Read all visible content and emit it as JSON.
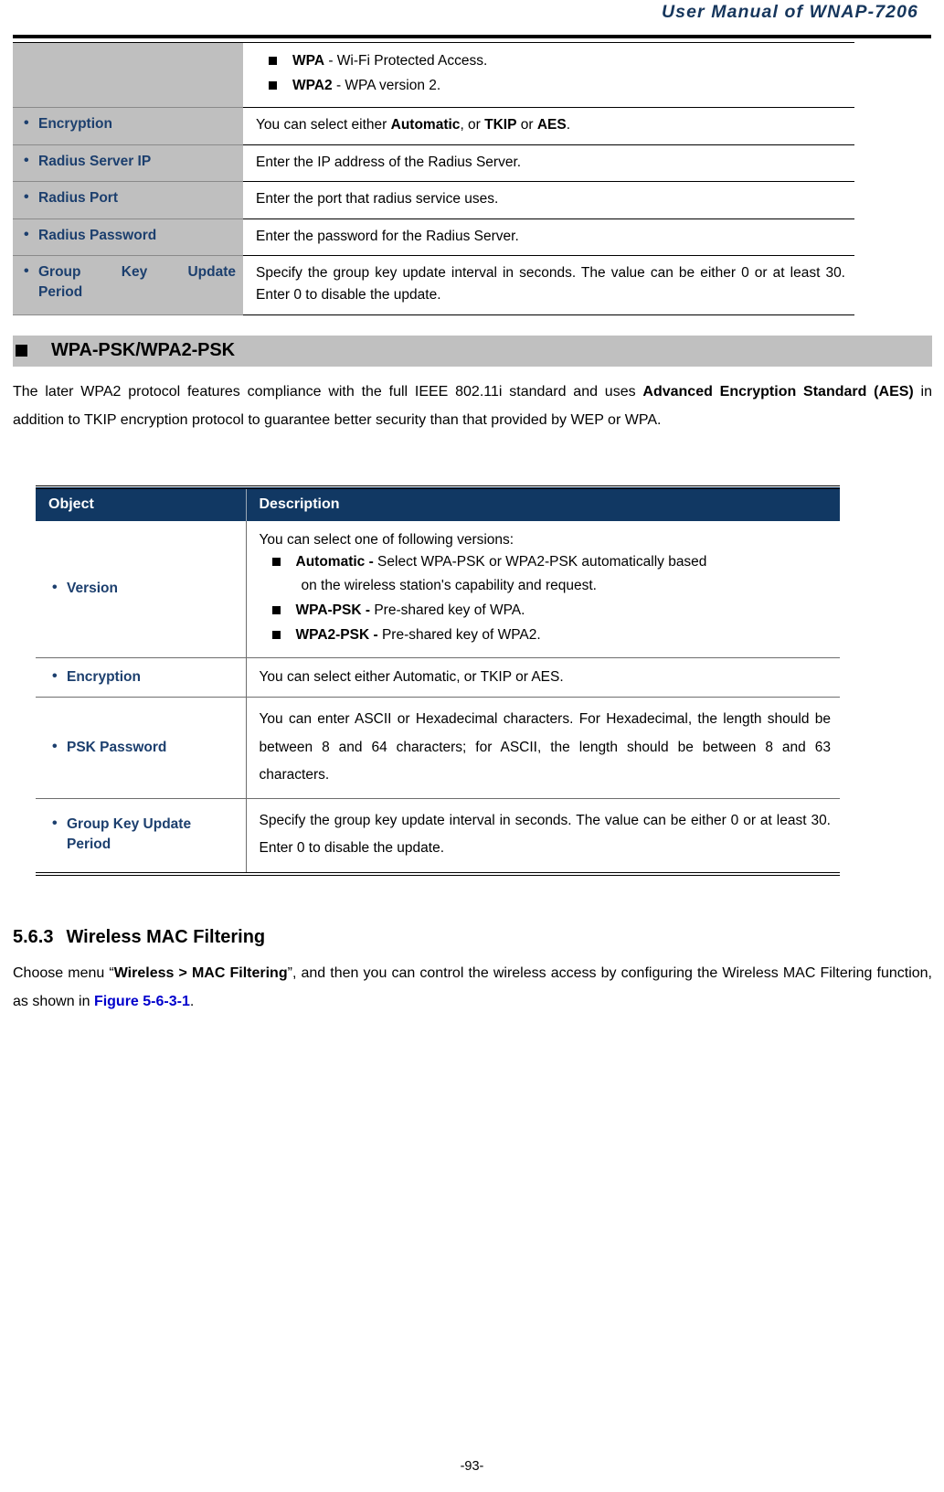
{
  "header": {
    "title": "User Manual of WNAP-7206"
  },
  "table_continued": {
    "rows": [
      {
        "object": "",
        "bullets": [
          {
            "term": "WPA",
            "rest": " - Wi-Fi Protected Access."
          },
          {
            "term": "WPA2",
            "rest": " - WPA version 2."
          }
        ]
      },
      {
        "object": "Encryption",
        "description_html": "You can select either <b>Automatic</b>, or <b>TKIP</b> or <b>AES</b>."
      },
      {
        "object": "Radius Server IP",
        "description_html": "Enter the IP address of the Radius Server."
      },
      {
        "object": "Radius Port",
        "description_html": "Enter the port that radius service uses."
      },
      {
        "object": "Radius Password",
        "description_html": "Enter the password for the Radius Server."
      },
      {
        "object": "Group Key Update",
        "object_line2": "Period",
        "description_html": "Specify the group key update interval in seconds. The value can be either 0 or at least 30. Enter 0 to disable the update."
      }
    ]
  },
  "section_banner": {
    "label": "WPA-PSK/WPA2-PSK"
  },
  "intro_paragraph": {
    "html": "The later WPA2 protocol features compliance with the full IEEE 802.11i standard and uses <b>Advanced Encryption Standard (AES)</b> in addition to TKIP encryption protocol to guarantee better security than that provided by WEP or WPA."
  },
  "table_psk": {
    "headers": {
      "object": "Object",
      "description": "Description"
    },
    "rows": [
      {
        "object": "Version",
        "intro": "You can select one of following versions:",
        "bullets": [
          {
            "term": "Automatic -",
            "rest": " Select WPA-PSK or WPA2-PSK automatically based",
            "rest2": "on the wireless station's capability and request."
          },
          {
            "term": "WPA-PSK -",
            "rest": " Pre-shared key of WPA."
          },
          {
            "term": "WPA2-PSK -",
            "rest": " Pre-shared key of WPA2."
          }
        ]
      },
      {
        "object": "Encryption",
        "description": "You can select either Automatic, or TKIP or AES."
      },
      {
        "object": "PSK Password",
        "description": "You can enter ASCII or Hexadecimal characters. For Hexadecimal, the length should be between 8 and 64 characters; for ASCII, the length should be between 8 and 63 characters."
      },
      {
        "object": "Group Key Update",
        "object_line2": "Period",
        "description": "Specify the group key update interval in seconds. The value can be either 0 or at least 30. Enter 0 to disable the update."
      }
    ]
  },
  "heading": {
    "number": "5.6.3",
    "title": "Wireless MAC Filtering"
  },
  "closing_paragraph": {
    "html": "Choose menu &ldquo;<b>Wireless &gt; MAC Filtering</b>&rdquo;, and then you can control the wireless access by configuring the Wireless MAC Filtering function, as shown in <span class=\"lnk\">Figure 5-6-3-1</span>."
  },
  "footer": {
    "page_number": "-93-"
  },
  "colors": {
    "header_blue": "#16365c",
    "object_text_blue": "#1c3f6e",
    "table_header_navy": "#113863",
    "object_cell_gray": "#bfbfbf",
    "banner_gray": "#c0c0c0",
    "link_blue": "#0000cc"
  }
}
